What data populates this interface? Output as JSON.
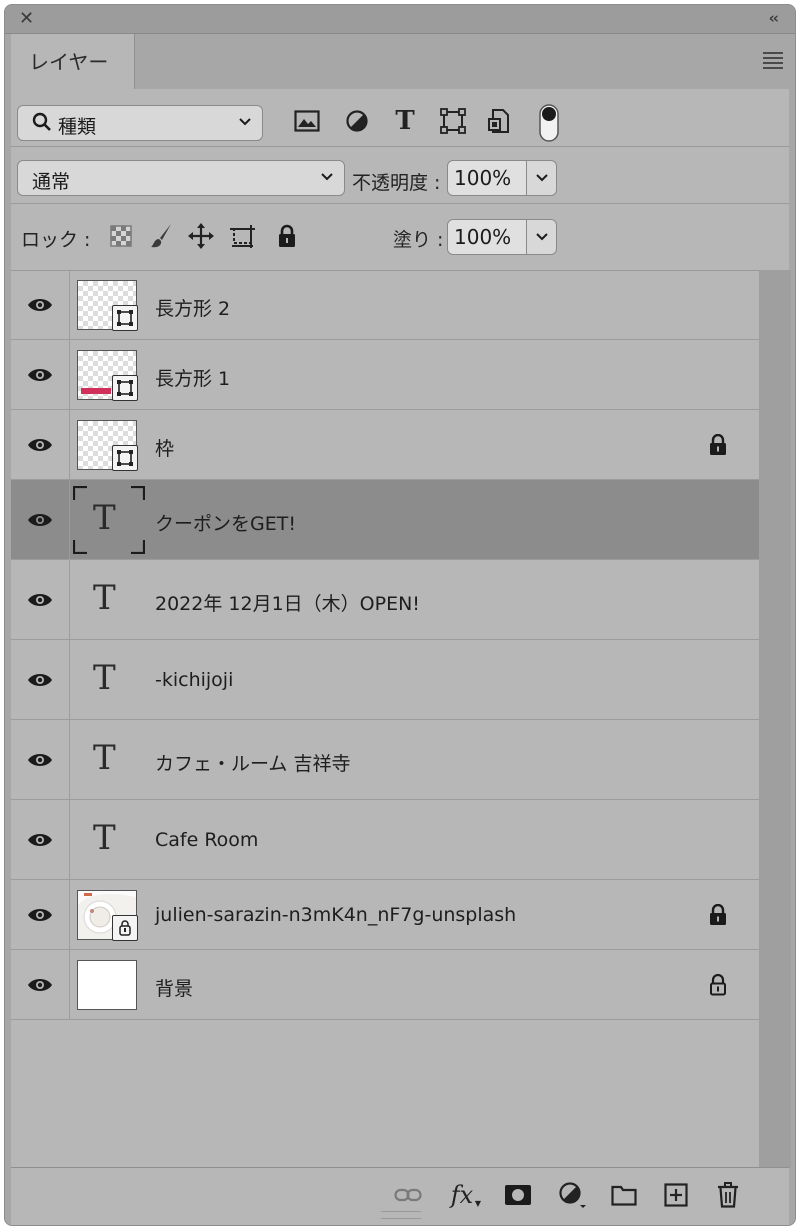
{
  "window": {
    "close_glyph": "✕",
    "collapse_glyph": "‹‹"
  },
  "tab": {
    "label": "レイヤー"
  },
  "filter": {
    "kind_label": "種類",
    "icons": [
      "image-filter-icon",
      "adjustment-filter-icon",
      "type-filter-icon",
      "shape-filter-icon",
      "smart-object-filter-icon",
      "filter-toggle-icon"
    ]
  },
  "blend": {
    "mode": "通常",
    "opacity_label": "不透明度 :",
    "opacity_value": "100%"
  },
  "lock": {
    "label": "ロック :",
    "fill_label": "塗り :",
    "fill_value": "100%",
    "icons": [
      "lock-transparent-pixels-icon",
      "lock-image-pixels-icon",
      "lock-position-icon",
      "lock-artboard-icon",
      "lock-all-icon"
    ]
  },
  "layers": [
    {
      "name": "長方形 2",
      "kind": "shape",
      "locked": false,
      "selected": false
    },
    {
      "name": "長方形 1",
      "kind": "shape",
      "locked": false,
      "selected": false,
      "accent": "#d0305a"
    },
    {
      "name": "枠",
      "kind": "shape",
      "locked": true,
      "selected": false
    },
    {
      "name": "クーポンをGET!",
      "kind": "text",
      "locked": false,
      "selected": true
    },
    {
      "name": "2022年 12月1日（木）OPEN!",
      "kind": "text",
      "locked": false,
      "selected": false
    },
    {
      "name": "-kichijoji",
      "kind": "text",
      "locked": false,
      "selected": false
    },
    {
      "name": "カフェ・ルーム 吉祥寺",
      "kind": "text",
      "locked": false,
      "selected": false
    },
    {
      "name": "Cafe Room",
      "kind": "text",
      "locked": false,
      "selected": false
    },
    {
      "name": "julien-sarazin-n3mK4n_nF7g-unsplash",
      "kind": "smart",
      "locked": true,
      "selected": false
    },
    {
      "name": "背景",
      "kind": "background",
      "locked": "partial",
      "selected": false
    }
  ],
  "type_glyph": "T",
  "bottom_icons": [
    "link-layers-icon",
    "fx-icon",
    "add-mask-icon",
    "new-adjustment-icon",
    "new-group-icon",
    "new-layer-icon",
    "delete-layer-icon"
  ],
  "fx_label": "fx",
  "colors": {
    "panel": "#b7b7b7",
    "selected_row": "#8c8c8c",
    "accent": "#d0305a"
  }
}
